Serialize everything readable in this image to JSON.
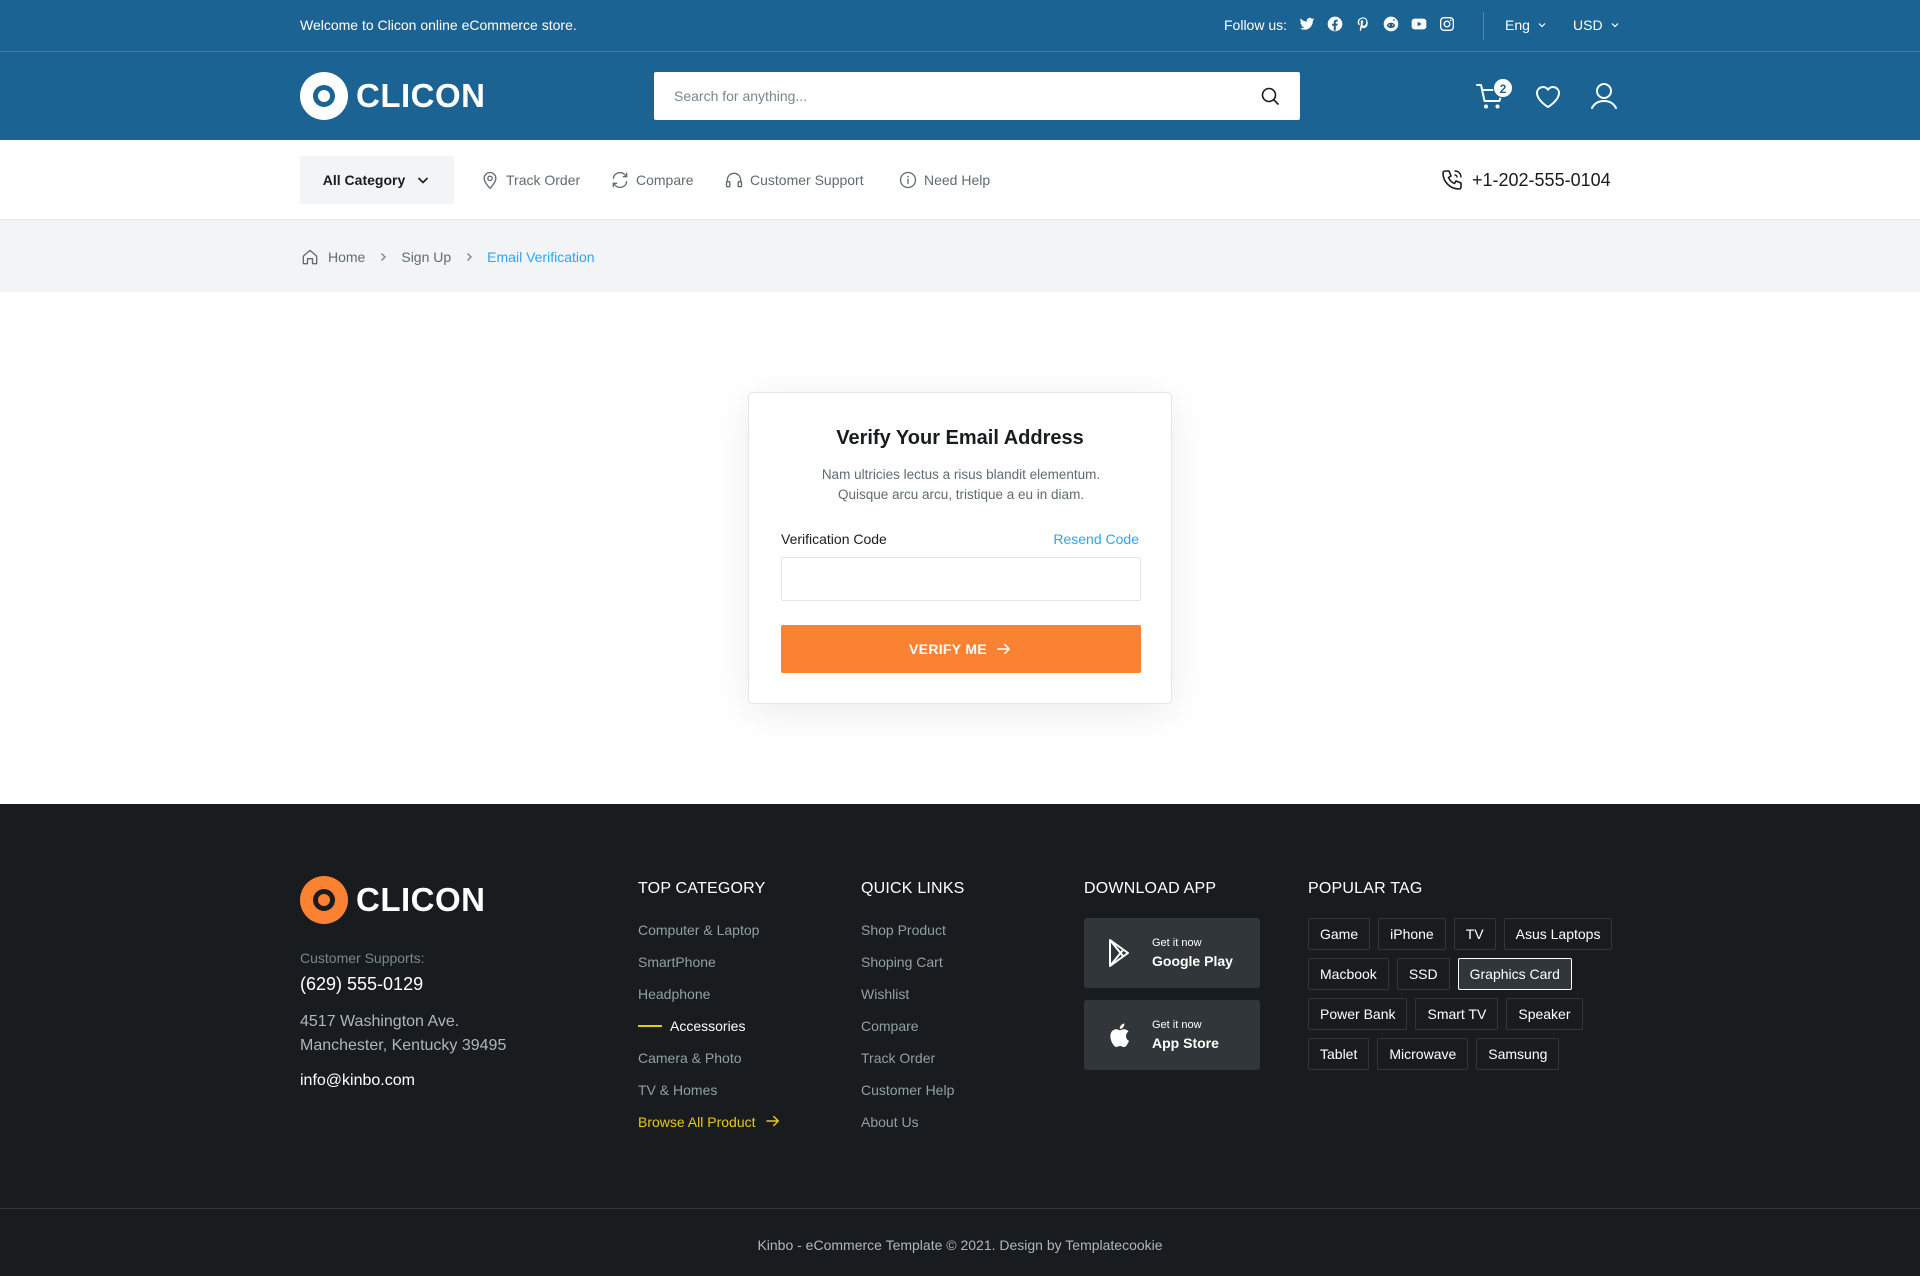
{
  "topbar": {
    "welcome": "Welcome to Clicon online eCommerce store.",
    "follow_label": "Follow us:",
    "socials": [
      "twitter-icon",
      "facebook-icon",
      "pinterest-icon",
      "reddit-icon",
      "youtube-icon",
      "instagram-icon"
    ],
    "language": "Eng",
    "currency": "USD"
  },
  "header": {
    "logo_text": "CLICON",
    "search_placeholder": "Search for anything...",
    "cart_count": "2"
  },
  "nav": {
    "all_category": "All Category",
    "links": [
      "Track Order",
      "Compare",
      "Customer Support",
      "Need Help"
    ],
    "phone": "+1-202-555-0104"
  },
  "breadcrumb": {
    "items": [
      "Home",
      "Sign Up",
      "Email Verification"
    ]
  },
  "verify": {
    "title": "Verify Your Email Address",
    "desc_line1": "Nam ultricies lectus a risus blandit elementum.",
    "desc_line2": "Quisque arcu arcu, tristique a eu in diam.",
    "code_label": "Verification Code",
    "resend_label": "Resend Code",
    "code_value": "",
    "button_label": "VERIFY ME"
  },
  "footer": {
    "logo_text": "CLICON",
    "support_label": "Customer Supports:",
    "support_phone": "(629) 555-0129",
    "address_line1": "4517 Washington Ave.",
    "address_line2": "Manchester, Kentucky 39495",
    "email": "info@kinbo.com",
    "top_category": {
      "title": "TOP CATEGORY",
      "items": [
        "Computer & Laptop",
        "SmartPhone",
        "Headphone",
        "Accessories",
        "Camera & Photo",
        "TV & Homes"
      ],
      "browse": "Browse All Product"
    },
    "quick_links": {
      "title": "QUICK LINKS",
      "items": [
        "Shop Product",
        "Shoping Cart",
        "Wishlist",
        "Compare",
        "Track Order",
        "Customer Help",
        "About Us"
      ]
    },
    "download_app": {
      "title": "DOWNLOAD APP",
      "google_small": "Get it now",
      "google_big": "Google Play",
      "apple_small": "Get it now",
      "apple_big": "App Store"
    },
    "popular_tag": {
      "title": "POPULAR TAG",
      "tags": [
        "Game",
        "iPhone",
        "TV",
        "Asus Laptops",
        "Macbook",
        "SSD",
        "Graphics Card",
        "Power Bank",
        "Smart TV",
        "Speaker",
        "Tablet",
        "Microwave",
        "Samsung"
      ],
      "selected": "Graphics Card"
    },
    "copyright": "Kinbo - eCommerce Template © 2021. Design by Templatecookie"
  },
  "colors": {
    "primary": "#1B6392",
    "accent": "#FA8232",
    "link": "#2DA5F3",
    "footer_bg": "#191C1F",
    "highlight": "#EBC80C"
  }
}
